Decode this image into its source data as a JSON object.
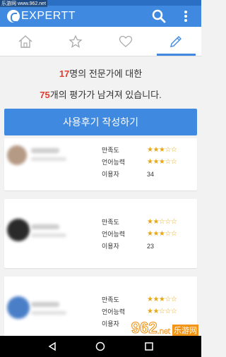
{
  "watermark": {
    "top": "乐游网 www.962.net",
    "brand": "962",
    "domain": ".net",
    "cn": "乐游网"
  },
  "appbar": {
    "logo_text": "EXPERT",
    "logo_tail": "T"
  },
  "tabs": [
    {
      "name": "home",
      "icon": "home-icon"
    },
    {
      "name": "favorites",
      "icon": "star-icon"
    },
    {
      "name": "likes",
      "icon": "heart-icon"
    },
    {
      "name": "reviews",
      "icon": "pencil-icon",
      "active": true
    }
  ],
  "summary": {
    "expert_count": "17",
    "line1_suffix": "명의 전문가에 대한",
    "remaining_count": "75",
    "line2_suffix": "개의 평가가 남겨져 있습니다."
  },
  "write_review_button": "사용후기 작성하기",
  "stat_labels": {
    "satisfaction": "만족도",
    "language": "언어능력",
    "users": "이용자"
  },
  "reviews": [
    {
      "satisfaction_stars": "★★★☆☆",
      "language_stars": "★★★☆☆",
      "users": "34"
    },
    {
      "satisfaction_stars": "★★☆☆☆",
      "language_stars": "★★★☆☆",
      "users": "23"
    },
    {
      "satisfaction_stars": "★★★☆☆",
      "language_stars": "★★☆☆☆",
      "users": ""
    }
  ],
  "colors": {
    "accent": "#3f8ae0",
    "highlight": "#e23b2e",
    "star": "#e6a817"
  }
}
